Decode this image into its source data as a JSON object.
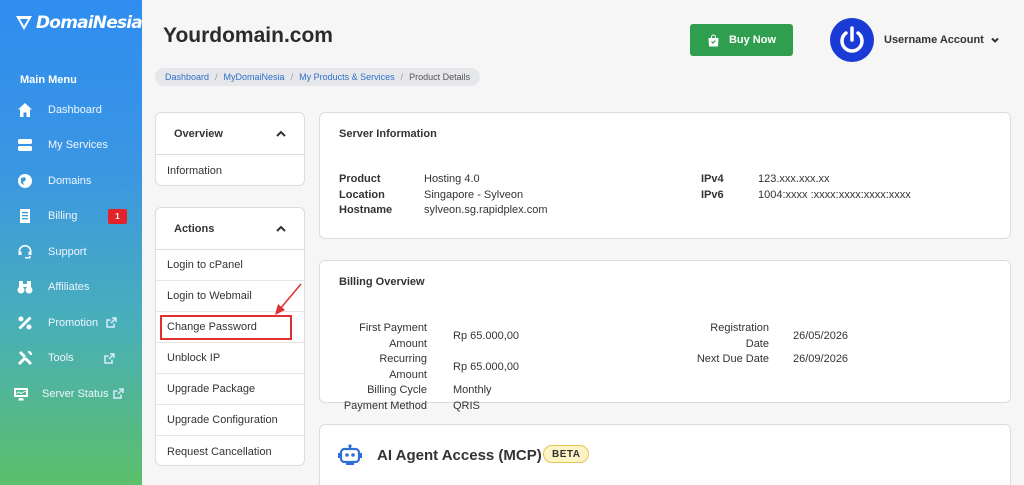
{
  "brand": {
    "name": "DomaiNesia"
  },
  "sidebar": {
    "heading": "Main Menu",
    "items": [
      {
        "label": "Dashboard",
        "icon": "home-icon"
      },
      {
        "label": "My Services",
        "icon": "server-icon"
      },
      {
        "label": "Domains",
        "icon": "globe-icon"
      },
      {
        "label": "Billing",
        "icon": "invoice-icon",
        "badge": "1"
      },
      {
        "label": "Support",
        "icon": "headset-icon"
      },
      {
        "label": "Affiliates",
        "icon": "binoculars-icon"
      },
      {
        "label": "Promotion",
        "icon": "percent-icon",
        "external": true
      },
      {
        "label": "Tools",
        "icon": "tools-icon",
        "external": true
      },
      {
        "label": "Server Status",
        "icon": "monitor-icon",
        "external": true
      }
    ]
  },
  "header": {
    "title": "Yourdomain.com",
    "buy_label": "Buy Now",
    "username": "Username Account"
  },
  "breadcrumb": [
    "Dashboard",
    "MyDomaiNesia",
    "My Products & Services",
    "Product Details"
  ],
  "overview": {
    "title": "Overview",
    "links": [
      "Information"
    ]
  },
  "actions": {
    "title": "Actions",
    "links": [
      "Login to cPanel",
      "Login to Webmail",
      "Change Password",
      "Unblock IP",
      "Upgrade Package",
      "Upgrade Configuration",
      "Request Cancellation"
    ]
  },
  "server_info": {
    "title": "Server Information",
    "product_label": "Product",
    "product": "Hosting 4.0",
    "location_label": "Location",
    "location": "Singapore - Sylveon",
    "hostname_label": "Hostname",
    "hostname": "sylveon.sg.rapidplex.com",
    "ipv4_label": "IPv4",
    "ipv4": "123.xxx.xxx.xx",
    "ipv6_label": "IPv6",
    "ipv6": "1004:xxxx :xxxx:xxxx:xxxx:xxxx"
  },
  "billing": {
    "title": "Billing Overview",
    "first_label": "First Payment Amount",
    "first": "Rp 65.000,00",
    "recurring_label": "Recurring Amount",
    "recurring": "Rp 65.000,00",
    "cycle_label": "Billing Cycle",
    "cycle": "Monthly",
    "method_label": "Payment Method",
    "method": "QRIS",
    "reg_label": "Registration Date",
    "reg": "26/05/2026",
    "due_label": "Next Due Date",
    "due": "26/09/2026"
  },
  "ai": {
    "title": "AI Agent Access (MCP)",
    "badge": "BETA"
  },
  "colors": {
    "accent_green": "#2f9e4e",
    "badge_red": "#e2242a",
    "avatar_blue": "#1a3bd6",
    "highlight_red": "#e03030"
  }
}
